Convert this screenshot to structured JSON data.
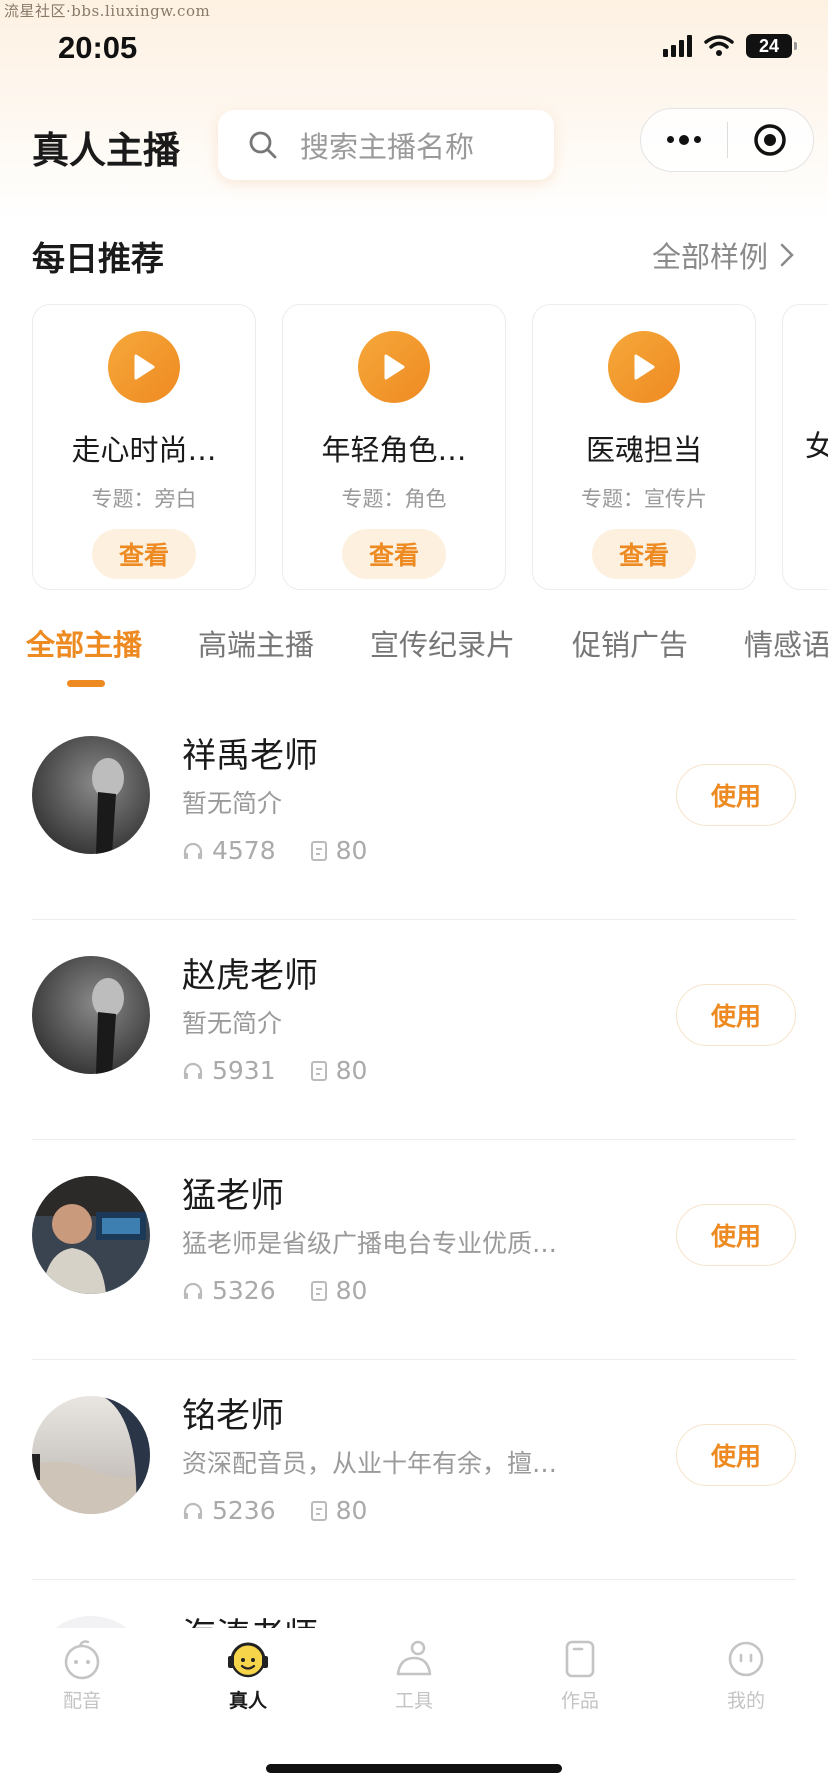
{
  "watermark": "流星社区·bbs.liuxingw.com",
  "status_bar": {
    "time": "20:05",
    "battery": "24"
  },
  "header": {
    "title": "真人主播",
    "search_placeholder": "搜索主播名称"
  },
  "daily": {
    "title": "每日推荐",
    "more_label": "全部样例",
    "cards": [
      {
        "name": "走心时尚…",
        "topic": "专题：旁白",
        "button": "查看"
      },
      {
        "name": "年轻角色…",
        "topic": "专题：角色",
        "button": "查看"
      },
      {
        "name": "医魂担当",
        "topic": "专题：宣传片",
        "button": "查看"
      },
      {
        "name": "女"
      }
    ]
  },
  "tabs": [
    {
      "label": "全部主播",
      "active": true
    },
    {
      "label": "高端主播"
    },
    {
      "label": "宣传纪录片"
    },
    {
      "label": "促销广告"
    },
    {
      "label": "情感语"
    }
  ],
  "anchors": [
    {
      "name": "祥禹老师",
      "intro": "暂无简介",
      "plays": "4578",
      "works": "80",
      "button": "使用"
    },
    {
      "name": "赵虎老师",
      "intro": "暂无简介",
      "plays": "5931",
      "works": "80",
      "button": "使用"
    },
    {
      "name": "猛老师",
      "intro": "猛老师是省级广播电台专业优质…",
      "plays": "5326",
      "works": "80",
      "button": "使用"
    },
    {
      "name": "铭老师",
      "intro": "资深配音员，从业十年有余，擅…",
      "plays": "5236",
      "works": "80",
      "button": "使用"
    },
    {
      "name": "海涛老师"
    }
  ],
  "bottom_nav": [
    {
      "label": "配音",
      "icon": "dubbing-face-icon"
    },
    {
      "label": "真人",
      "icon": "headphone-face-icon",
      "active": true
    },
    {
      "label": "工具",
      "icon": "tool-person-icon"
    },
    {
      "label": "作品",
      "icon": "works-card-icon"
    },
    {
      "label": "我的",
      "icon": "profile-face-icon"
    }
  ],
  "colors": {
    "accent": "#ee8a22",
    "accent_light": "#fdf0df",
    "active_tab_text": "#ee8a22"
  }
}
